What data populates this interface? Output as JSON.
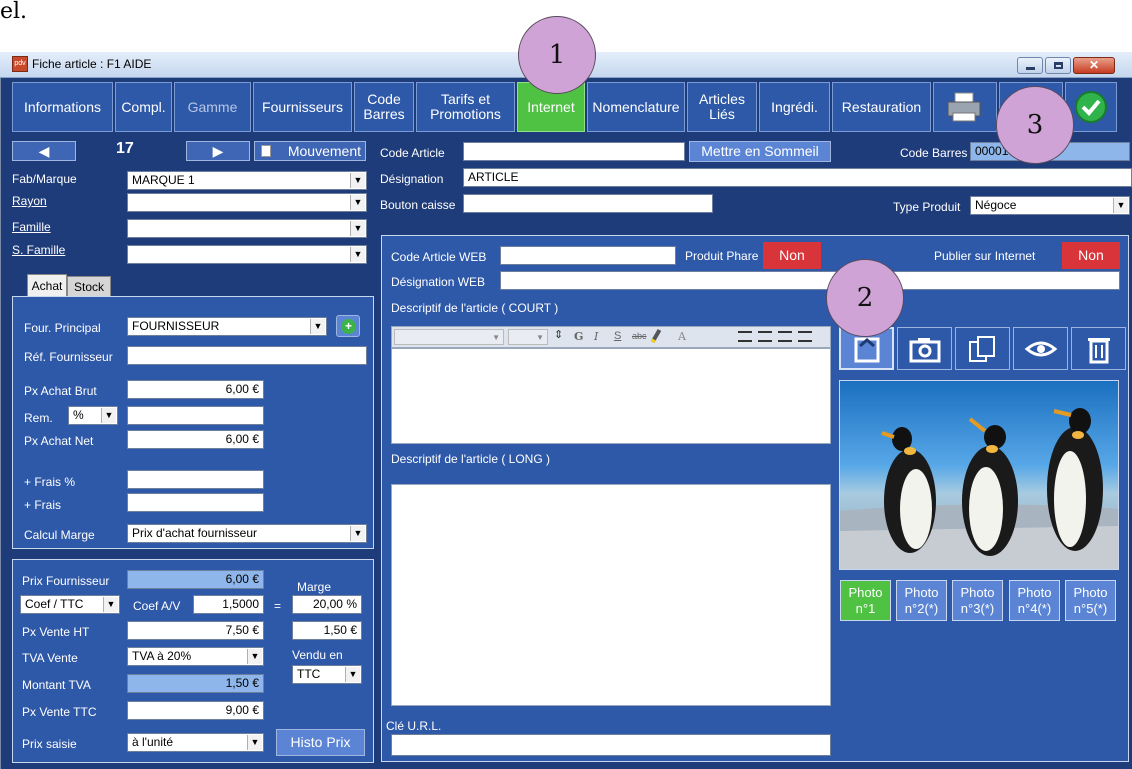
{
  "header_text": "el.",
  "window": {
    "title": "Fiche article : F1 AIDE",
    "app_icon_text": "pdv"
  },
  "tabs": [
    {
      "label": "Informations"
    },
    {
      "label": "Compl."
    },
    {
      "label": "Gamme"
    },
    {
      "label": "Fournisseurs"
    },
    {
      "label": "Code Barres"
    },
    {
      "label": "Tarifs et Promotions"
    },
    {
      "label": "Internet"
    },
    {
      "label": "Nomenclature"
    },
    {
      "label": "Articles Liés"
    },
    {
      "label": "Ingrédi."
    },
    {
      "label": "Restauration"
    }
  ],
  "nav": {
    "counter": "17",
    "mouvement": "Mouvement"
  },
  "left": {
    "fab_label": "Fab/Marque",
    "fab_value": "MARQUE 1",
    "rayon_label": "Rayon",
    "famille_label": "Famille",
    "sfamille_label": "S. Famille",
    "subtabs": [
      "Achat",
      "Stock"
    ],
    "four_label": "Four. Principal",
    "four_value": "FOURNISSEUR",
    "ref_label": "Réf. Fournisseur",
    "pxbrut_label": "Px Achat Brut",
    "pxbrut_value": "6,00 €",
    "rem_label": "Rem.",
    "rem_unit": "%",
    "pxnet_label": "Px Achat Net",
    "pxnet_value": "6,00 €",
    "frais_pct_label": "+ Frais %",
    "frais_label": "+ Frais",
    "calcul_label": "Calcul Marge",
    "calcul_value": "Prix d'achat fournisseur",
    "prixfour_label": "Prix Fournisseur",
    "prixfour_value": "6,00 €",
    "marge_label": "Marge",
    "coef_type": "Coef / TTC",
    "coef_label": "Coef A/V",
    "coef_value": "1,5000",
    "eq": "=",
    "marge_pct": "20,00 %",
    "pvht_label": "Px Vente HT",
    "pvht_value": "7,50 €",
    "marge_value": "1,50 €",
    "tva_label": "TVA Vente",
    "tva_value": "TVA à 20%",
    "vendu_label": "Vendu en",
    "vendu_value": "TTC",
    "mtva_label": "Montant TVA",
    "mtva_value": "1,50 €",
    "pvttc_label": "Px Vente TTC",
    "pvttc_value": "9,00 €",
    "prixsaisie_label": "Prix saisie",
    "prixsaisie_value": "à l'unité",
    "histo": "Histo Prix"
  },
  "top": {
    "code_label": "Code Article",
    "sommeil": "Mettre en Sommeil",
    "codebarres_label": "Code Barres",
    "codebarres_value": "00001",
    "desig_label": "Désignation",
    "desig_value": "ARTICLE",
    "bouton_label": "Bouton caisse",
    "type_label": "Type Produit",
    "type_value": "Négoce"
  },
  "web": {
    "code_label": "Code Article WEB",
    "phare_label": "Produit Phare",
    "phare_value": "Non",
    "publier_label": "Publier sur Internet",
    "publier_value": "Non",
    "desig_label": "Désignation WEB",
    "court_label": "Descriptif de l'article ( COURT )",
    "long_label": "Descriptif de l'article ( LONG )",
    "cle_label": "Clé U.R.L.",
    "toolbar": [
      "G",
      "I",
      "S",
      "abc",
      "A"
    ]
  },
  "photos": [
    "Photo n°1",
    "Photo n°2(*)",
    "Photo n°3(*)",
    "Photo n°4(*)",
    "Photo n°5(*)"
  ],
  "annotations": [
    "1",
    "2",
    "3"
  ],
  "colors": {
    "bg": "#1f3c7a",
    "panel": "#2e58a8",
    "active": "#4fc244",
    "red": "#d9343a"
  }
}
